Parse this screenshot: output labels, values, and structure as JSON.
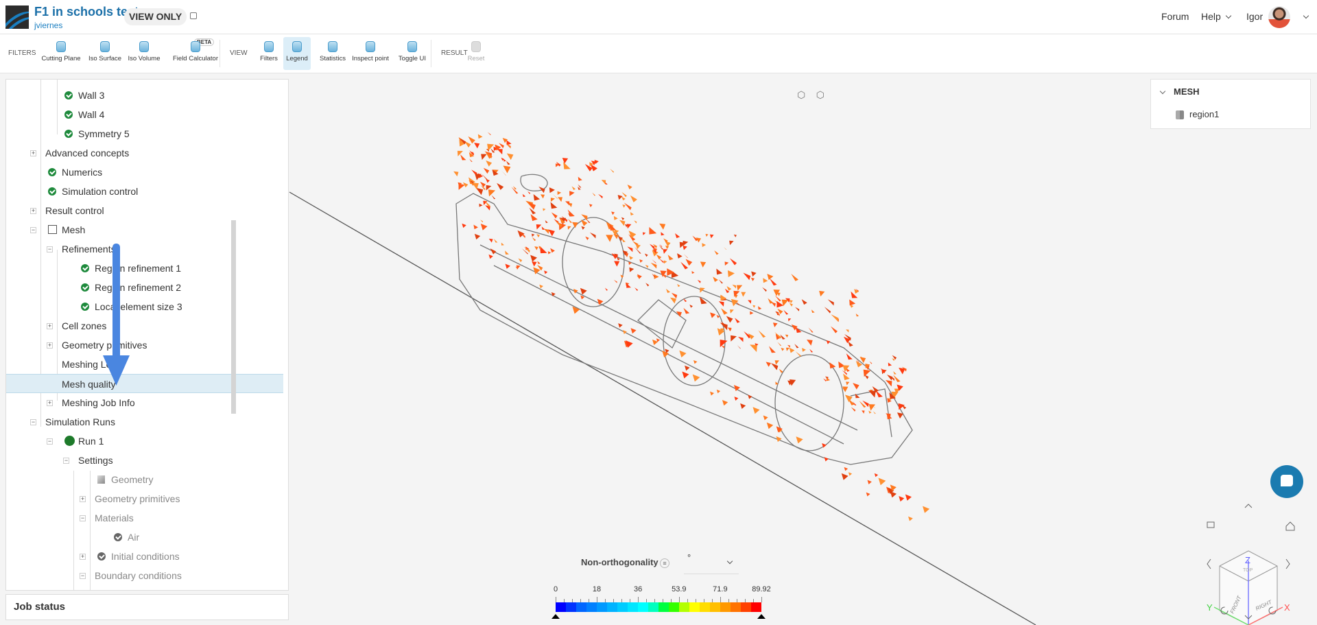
{
  "header": {
    "project_title": "F1 in schools test",
    "owner": "jviernes",
    "badge": "VIEW ONLY",
    "forum": "Forum",
    "help": "Help",
    "user": "Igor"
  },
  "toolbar": {
    "filters_label": "FILTERS",
    "view_label": "VIEW",
    "result_label": "RESULT",
    "beta": "BETA",
    "buttons": [
      {
        "label": "Cutting Plane",
        "icon": "cutting-plane-icon"
      },
      {
        "label": "Iso Surface",
        "icon": "iso-surface-icon"
      },
      {
        "label": "Iso Volume",
        "icon": "iso-volume-icon"
      },
      {
        "label": "Field Calculator",
        "icon": "field-calculator-icon"
      },
      {
        "label": "Filters",
        "icon": "filters-icon"
      },
      {
        "label": "Legend",
        "icon": "legend-icon",
        "active": true
      },
      {
        "label": "Statistics",
        "icon": "statistics-icon"
      },
      {
        "label": "Inspect point",
        "icon": "inspect-point-icon"
      },
      {
        "label": "Toggle UI",
        "icon": "toggle-ui-icon"
      },
      {
        "label": "Reset",
        "icon": "reset-icon",
        "disabled": true
      }
    ]
  },
  "tree": [
    {
      "label": "Wall 3",
      "level": 2,
      "icon": "check"
    },
    {
      "label": "Wall 4",
      "level": 2,
      "icon": "check"
    },
    {
      "label": "Symmetry 5",
      "level": 2,
      "icon": "check"
    },
    {
      "label": "Advanced concepts",
      "level": 1,
      "exp": "+"
    },
    {
      "label": "Numerics",
      "level": 1,
      "icon": "check"
    },
    {
      "label": "Simulation control",
      "level": 1,
      "icon": "check"
    },
    {
      "label": "Result control",
      "level": 1,
      "exp": "+"
    },
    {
      "label": "Mesh",
      "level": 1,
      "exp": "-",
      "icon": "mesh"
    },
    {
      "label": "Refinements",
      "level": 2,
      "exp": "-"
    },
    {
      "label": "Region refinement 1",
      "level": 3,
      "icon": "check"
    },
    {
      "label": "Region refinement 2",
      "level": 3,
      "icon": "check"
    },
    {
      "label": "Local element size 3",
      "level": 3,
      "icon": "check"
    },
    {
      "label": "Cell zones",
      "level": 2,
      "exp": "+"
    },
    {
      "label": "Geometry primitives",
      "level": 2,
      "exp": "+"
    },
    {
      "label": "Meshing Log",
      "level": 2
    },
    {
      "label": "Mesh quality",
      "level": 2,
      "selected": true
    },
    {
      "label": "Meshing Job Info",
      "level": 2,
      "exp": "+"
    },
    {
      "label": "Simulation Runs",
      "level": 1,
      "exp": "-"
    },
    {
      "label": "Run 1",
      "level": 2,
      "exp": "-",
      "icon": "gear"
    },
    {
      "label": "Settings",
      "level": 3,
      "exp": "-"
    },
    {
      "label": "Geometry",
      "level": 4,
      "icon": "geometry",
      "grey": true
    },
    {
      "label": "Geometry primitives",
      "level": 4,
      "exp": "+",
      "grey": true
    },
    {
      "label": "Materials",
      "level": 4,
      "exp": "-",
      "grey": true
    },
    {
      "label": "Air",
      "level": 5,
      "icon": "check-grey",
      "grey": true
    },
    {
      "label": "Initial conditions",
      "level": 4,
      "exp": "+",
      "icon": "check-grey",
      "grey": true
    },
    {
      "label": "Boundary conditions",
      "level": 4,
      "exp": "-",
      "grey": true
    }
  ],
  "job_status": "Job status",
  "mesh_panel": {
    "title": "MESH",
    "items": [
      "region1"
    ]
  },
  "legend": {
    "title": "Non-orthogonality",
    "unit": "°",
    "min": 0,
    "max": 89.92,
    "ticks": [
      "0",
      "18",
      "36",
      "53.9",
      "71.9",
      "89.92"
    ],
    "colors": [
      "#0000ff",
      "#0033ff",
      "#0066ff",
      "#0080ff",
      "#0099ff",
      "#00b3ff",
      "#00ccff",
      "#00e6ff",
      "#00ffff",
      "#00ffbf",
      "#00ff40",
      "#33ff00",
      "#b3ff00",
      "#ffff00",
      "#ffdd00",
      "#ffbf00",
      "#ff9900",
      "#ff7300",
      "#ff4000",
      "#ff0000"
    ]
  },
  "navcube": {
    "axes": [
      "X",
      "Y",
      "Z"
    ],
    "faces": [
      "TOP",
      "FRONT",
      "RIGHT"
    ]
  },
  "colors": {
    "accent": "#1a7fc1",
    "selected_row": "#deedf5",
    "check": "#1e8a3c",
    "mesh": "#ff5a1a"
  }
}
